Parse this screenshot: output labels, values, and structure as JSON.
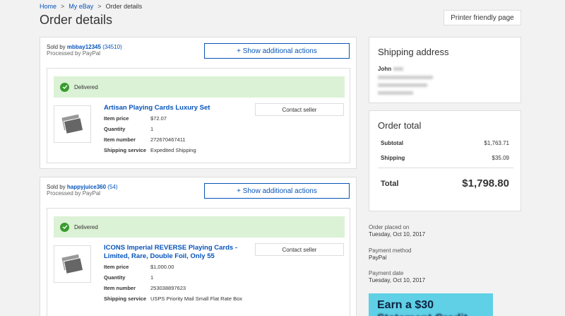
{
  "breadcrumb": [
    "Home",
    "My eBay",
    "Order details"
  ],
  "page_title": "Order details",
  "printer_button": "Printer friendly page",
  "orders": [
    {
      "sold_by_prefix": "Sold by",
      "seller": "mbbay12345",
      "feedback": "34510",
      "processed_by": "Processed by PayPal",
      "actions_label": "+ Show additional actions",
      "status": "Delivered",
      "item_title": "Artisan Playing Cards Luxury Set",
      "contact_label": "Contact seller",
      "details": [
        {
          "label": "Item price",
          "value": "$72.07"
        },
        {
          "label": "Quantity",
          "value": "1"
        },
        {
          "label": "Item number",
          "value": "272670467411"
        },
        {
          "label": "Shipping service",
          "value": "Expedited Shipping"
        }
      ]
    },
    {
      "sold_by_prefix": "Sold by",
      "seller": "happyjuice360",
      "feedback": "54",
      "processed_by": "Processed by PayPal",
      "actions_label": "+ Show additional actions",
      "status": "Delivered",
      "item_title_line1": "ICONS Imperial REVERSE Playing Cards -",
      "item_title_line2": "Limited, Rare, Double Foil, Only 55",
      "contact_label": "Contact seller",
      "details": [
        {
          "label": "Item price",
          "value": "$1,000.00"
        },
        {
          "label": "Quantity",
          "value": "1"
        },
        {
          "label": "Item number",
          "value": "253038897623"
        },
        {
          "label": "Shipping service",
          "value": "USPS Priority Mail Small Flat Rate Box"
        }
      ]
    }
  ],
  "shipping": {
    "heading": "Shipping address",
    "name": "John"
  },
  "order_total": {
    "heading": "Order total",
    "subtotal_label": "Subtotal",
    "subtotal": "$1,763.71",
    "shipping_label": "Shipping",
    "shipping": "$35.09",
    "total_label": "Total",
    "total": "$1,798.80"
  },
  "meta": {
    "order_placed_label": "Order placed on",
    "order_placed": "Tuesday, Oct 10, 2017",
    "payment_method_label": "Payment method",
    "payment_method": "PayPal",
    "payment_date_label": "Payment date",
    "payment_date": "Tuesday, Oct 10, 2017"
  },
  "ad": {
    "line1": "Earn a $30"
  },
  "colors": {
    "link": "#0654ba",
    "delivered_bg": "#dcf2d6",
    "check": "#3a9b2f",
    "ad_bg": "#5fd0e6"
  }
}
